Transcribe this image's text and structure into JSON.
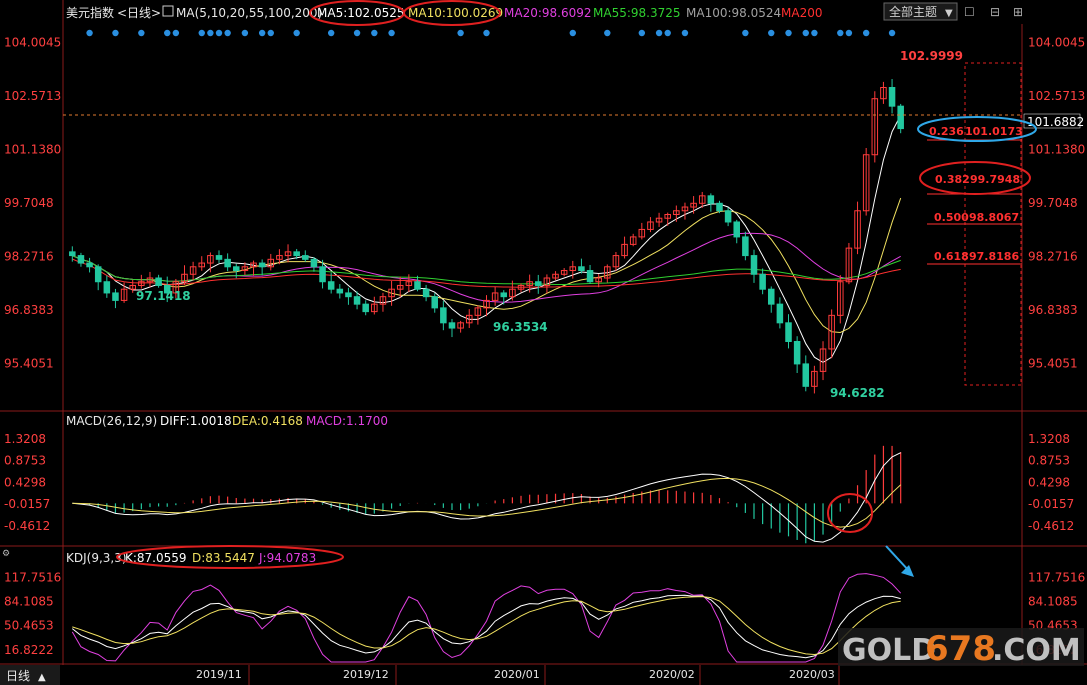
{
  "header": {
    "title": "美元指数",
    "period": "<日线>",
    "ma_label": "MA(5,10,20,55,100,200)",
    "ma_values": [
      {
        "name": "MA5",
        "text": "MA5:102.0525",
        "color": "#ffffff"
      },
      {
        "name": "MA10",
        "text": "MA10:100.0269",
        "color": "#f0e060"
      },
      {
        "name": "MA20",
        "text": "MA20:98.6092",
        "color": "#e040e0"
      },
      {
        "name": "MA55",
        "text": "MA55:98.3725",
        "color": "#30d030"
      },
      {
        "name": "MA100",
        "text": "MA100:98.0524",
        "color": "#a0a0a0"
      },
      {
        "name": "MA200",
        "text": "MA200",
        "color": "#ff3030"
      }
    ],
    "theme_select": "全部主题",
    "dropdown_glyph": "▼"
  },
  "window_controls": [
    "☐",
    "⊟",
    "⊞",
    "✕"
  ],
  "price_axis": {
    "ticks": [
      "104.0045",
      "102.5713",
      "101.1380",
      "99.7048",
      "98.2716",
      "96.8383",
      "95.4051"
    ],
    "current": "101.6882"
  },
  "annotations": {
    "high": "102.9999",
    "low": "94.6282",
    "low_nov": "97.1418",
    "low_jan": "96.3534"
  },
  "fibonacci": [
    {
      "ratio": "0.236",
      "value": "101.0173"
    },
    {
      "ratio": "0.382",
      "value": "99.7948"
    },
    {
      "ratio": "0.500",
      "value": "98.8067"
    },
    {
      "ratio": "0.618",
      "value": "97.8186"
    }
  ],
  "macd": {
    "label": "MACD(26,12,9)",
    "diff": "DIFF:1.0018",
    "dea": "DEA:0.4168",
    "macd": "MACD:1.1700",
    "ticks": [
      "1.3208",
      "0.8753",
      "0.4298",
      "-0.0157",
      "-0.4612"
    ]
  },
  "kdj": {
    "label": "KDJ(9,3,3)",
    "k": "K:87.0559",
    "d": "D:83.5447",
    "j": "J:94.0783",
    "ticks": [
      "117.7516",
      "84.1085",
      "50.4653",
      "16.8222"
    ]
  },
  "x_axis": {
    "ticks": [
      "2019/11",
      "2019/12",
      "2020/01",
      "2020/02",
      "2020/03"
    ],
    "period_button": "日线",
    "period_arrow": "▲"
  },
  "watermark": {
    "prefix": "GOLD",
    "digits": "678",
    "suffix": ".COM"
  },
  "colors": {
    "up": "#ff3b3b",
    "down": "#22c8a0",
    "ma5": "#ffffff",
    "ma10": "#f0e060",
    "ma20": "#e040e0",
    "ma55": "#30d030",
    "ma100": "#a0a0a0",
    "ma200": "#ff3030",
    "axis": "#8a1a1a",
    "grid": "#5a0d0d",
    "signal_dot": "#2a8fe0",
    "highlight_red": "#e02020",
    "highlight_blue": "#30a8e8"
  },
  "chart_data": {
    "type": "candlestick",
    "symbol": "美元指数",
    "period": "日线",
    "price_range": [
      94.3,
      104.5
    ],
    "x_categories": [
      "2019/11",
      "2019/12",
      "2020/01",
      "2020/02",
      "2020/03"
    ],
    "approx_close": [
      98.3,
      98.1,
      98.0,
      97.6,
      97.3,
      97.1,
      97.4,
      97.5,
      97.6,
      97.7,
      97.5,
      97.3,
      97.6,
      97.8,
      98.0,
      98.1,
      98.3,
      98.2,
      98.0,
      97.9,
      98.0,
      98.1,
      98.0,
      98.2,
      98.3,
      98.4,
      98.3,
      98.2,
      98.0,
      97.6,
      97.4,
      97.3,
      97.2,
      97.0,
      96.8,
      97.0,
      97.2,
      97.4,
      97.5,
      97.6,
      97.4,
      97.2,
      96.9,
      96.5,
      96.36,
      96.5,
      96.7,
      96.9,
      97.1,
      97.3,
      97.2,
      97.4,
      97.5,
      97.6,
      97.5,
      97.7,
      97.8,
      97.9,
      98.0,
      97.9,
      97.6,
      97.7,
      98.0,
      98.3,
      98.6,
      98.8,
      99.0,
      99.2,
      99.3,
      99.4,
      99.5,
      99.6,
      99.7,
      99.9,
      99.7,
      99.5,
      99.2,
      98.8,
      98.3,
      97.8,
      97.4,
      97.0,
      96.5,
      96.0,
      95.4,
      94.8,
      95.2,
      95.8,
      96.7,
      97.6,
      98.5,
      99.5,
      101.0,
      102.5,
      102.8,
      102.3,
      101.7
    ],
    "series": [
      {
        "name": "MA5",
        "latest": 102.0525
      },
      {
        "name": "MA10",
        "latest": 100.0269
      },
      {
        "name": "MA20",
        "latest": 98.6092
      },
      {
        "name": "MA55",
        "latest": 98.3725
      },
      {
        "name": "MA100",
        "latest": 98.0524
      }
    ],
    "current": 101.6882,
    "high": 102.9999,
    "low": 94.6282,
    "fib_levels": [
      {
        "ratio": 0.236,
        "value": 101.0173
      },
      {
        "ratio": 0.382,
        "value": 99.7948
      },
      {
        "ratio": 0.5,
        "value": 98.8067
      },
      {
        "ratio": 0.618,
        "value": 97.8186
      }
    ],
    "macd": {
      "diff": 1.0018,
      "dea": 0.4168,
      "macd": 1.17,
      "range": [
        -0.75,
        1.5
      ]
    },
    "kdj": {
      "k": 87.0559,
      "d": 83.5447,
      "j": 94.0783,
      "range": [
        0,
        135
      ]
    },
    "grid": false
  }
}
